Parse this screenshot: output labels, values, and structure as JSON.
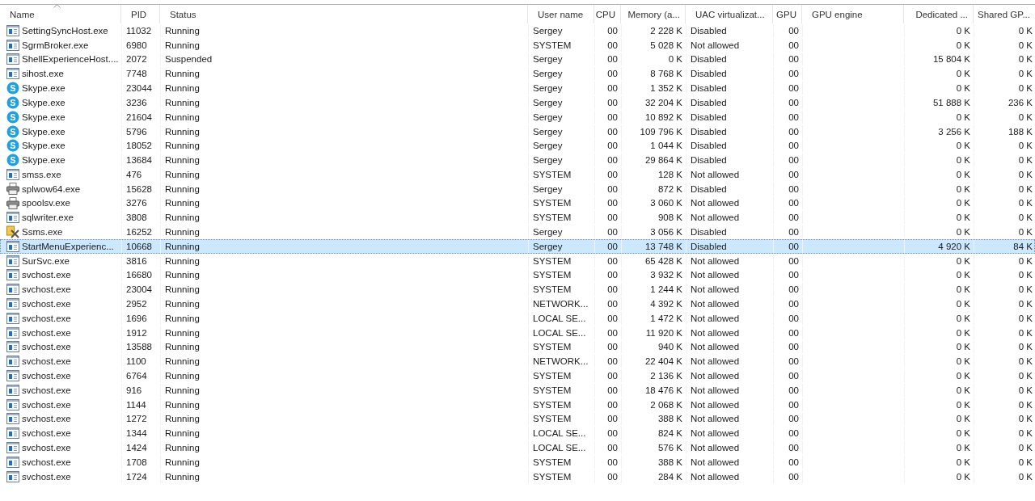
{
  "table": {
    "columns": [
      {
        "label": "Name",
        "sorted": true
      },
      {
        "label": "PID",
        "sorted": false
      },
      {
        "label": "Status",
        "sorted": false
      },
      {
        "label": "User name",
        "sorted": false
      },
      {
        "label": "CPU",
        "sorted": false
      },
      {
        "label": "Memory (a...",
        "sorted": false
      },
      {
        "label": "UAC virtualizat...",
        "sorted": false
      },
      {
        "label": "GPU",
        "sorted": false
      },
      {
        "label": "GPU engine",
        "sorted": false
      },
      {
        "label": "Dedicated ...",
        "sorted": false
      },
      {
        "label": "Shared GP...",
        "sorted": false
      }
    ],
    "rows": [
      {
        "kind": "app",
        "selected": false,
        "cells": [
          "SettingSyncHost.exe",
          "11032",
          "Running",
          "Sergey",
          "00",
          "2 228 K",
          "Disabled",
          "00",
          "",
          "0 K",
          "0 K"
        ]
      },
      {
        "kind": "app",
        "selected": false,
        "cells": [
          "SgrmBroker.exe",
          "6980",
          "Running",
          "SYSTEM",
          "00",
          "5 028 K",
          "Not allowed",
          "00",
          "",
          "0 K",
          "0 K"
        ]
      },
      {
        "kind": "app",
        "selected": false,
        "cells": [
          "ShellExperienceHost....",
          "2072",
          "Suspended",
          "Sergey",
          "00",
          "0 K",
          "Disabled",
          "00",
          "",
          "15 804 K",
          "0 K"
        ]
      },
      {
        "kind": "app",
        "selected": false,
        "cells": [
          "sihost.exe",
          "7748",
          "Running",
          "Sergey",
          "00",
          "8 768 K",
          "Disabled",
          "00",
          "",
          "0 K",
          "0 K"
        ]
      },
      {
        "kind": "skype",
        "icon_text": "S",
        "selected": false,
        "cells": [
          "Skype.exe",
          "23044",
          "Running",
          "Sergey",
          "00",
          "1 352 K",
          "Disabled",
          "00",
          "",
          "0 K",
          "0 K"
        ]
      },
      {
        "kind": "skype",
        "icon_text": "S",
        "selected": false,
        "cells": [
          "Skype.exe",
          "3236",
          "Running",
          "Sergey",
          "00",
          "32 204 K",
          "Disabled",
          "00",
          "",
          "51 888 K",
          "236 K"
        ]
      },
      {
        "kind": "skype",
        "icon_text": "S",
        "selected": false,
        "cells": [
          "Skype.exe",
          "21604",
          "Running",
          "Sergey",
          "00",
          "10 892 K",
          "Disabled",
          "00",
          "",
          "0 K",
          "0 K"
        ]
      },
      {
        "kind": "skype",
        "icon_text": "S",
        "selected": false,
        "cells": [
          "Skype.exe",
          "5796",
          "Running",
          "Sergey",
          "00",
          "109 796 K",
          "Disabled",
          "00",
          "",
          "3 256 K",
          "188 K"
        ]
      },
      {
        "kind": "skype",
        "icon_text": "S",
        "selected": false,
        "cells": [
          "Skype.exe",
          "18052",
          "Running",
          "Sergey",
          "00",
          "1 044 K",
          "Disabled",
          "00",
          "",
          "0 K",
          "0 K"
        ]
      },
      {
        "kind": "skype",
        "icon_text": "S",
        "selected": false,
        "cells": [
          "Skype.exe",
          "13684",
          "Running",
          "Sergey",
          "00",
          "29 864 K",
          "Disabled",
          "00",
          "",
          "0 K",
          "0 K"
        ]
      },
      {
        "kind": "app",
        "selected": false,
        "cells": [
          "smss.exe",
          "476",
          "Running",
          "SYSTEM",
          "00",
          "128 K",
          "Not allowed",
          "00",
          "",
          "0 K",
          "0 K"
        ]
      },
      {
        "kind": "printer",
        "selected": false,
        "cells": [
          "splwow64.exe",
          "15628",
          "Running",
          "Sergey",
          "00",
          "872 K",
          "Disabled",
          "00",
          "",
          "0 K",
          "0 K"
        ]
      },
      {
        "kind": "printer",
        "selected": false,
        "cells": [
          "spoolsv.exe",
          "3276",
          "Running",
          "SYSTEM",
          "00",
          "3 060 K",
          "Not allowed",
          "00",
          "",
          "0 K",
          "0 K"
        ]
      },
      {
        "kind": "app",
        "selected": false,
        "cells": [
          "sqlwriter.exe",
          "3808",
          "Running",
          "SYSTEM",
          "00",
          "908 K",
          "Not allowed",
          "00",
          "",
          "0 K",
          "0 K"
        ]
      },
      {
        "kind": "tools",
        "selected": false,
        "cells": [
          "Ssms.exe",
          "16252",
          "Running",
          "Sergey",
          "00",
          "3 056 K",
          "Disabled",
          "00",
          "",
          "0 K",
          "0 K"
        ]
      },
      {
        "kind": "app",
        "selected": true,
        "cells": [
          "StartMenuExperienc...",
          "10668",
          "Running",
          "Sergey",
          "00",
          "13 748 K",
          "Disabled",
          "00",
          "",
          "4 920 K",
          "84 K"
        ]
      },
      {
        "kind": "app",
        "selected": false,
        "cells": [
          "SurSvc.exe",
          "3816",
          "Running",
          "SYSTEM",
          "00",
          "65 428 K",
          "Not allowed",
          "00",
          "",
          "0 K",
          "0 K"
        ]
      },
      {
        "kind": "app",
        "selected": false,
        "cells": [
          "svchost.exe",
          "16680",
          "Running",
          "SYSTEM",
          "00",
          "3 932 K",
          "Not allowed",
          "00",
          "",
          "0 K",
          "0 K"
        ]
      },
      {
        "kind": "app",
        "selected": false,
        "cells": [
          "svchost.exe",
          "23004",
          "Running",
          "SYSTEM",
          "00",
          "1 244 K",
          "Not allowed",
          "00",
          "",
          "0 K",
          "0 K"
        ]
      },
      {
        "kind": "app",
        "selected": false,
        "cells": [
          "svchost.exe",
          "2952",
          "Running",
          "NETWORK...",
          "00",
          "4 392 K",
          "Not allowed",
          "00",
          "",
          "0 K",
          "0 K"
        ]
      },
      {
        "kind": "app",
        "selected": false,
        "cells": [
          "svchost.exe",
          "1696",
          "Running",
          "LOCAL SE...",
          "00",
          "1 472 K",
          "Not allowed",
          "00",
          "",
          "0 K",
          "0 K"
        ]
      },
      {
        "kind": "app",
        "selected": false,
        "cells": [
          "svchost.exe",
          "1912",
          "Running",
          "LOCAL SE...",
          "00",
          "11 920 K",
          "Not allowed",
          "00",
          "",
          "0 K",
          "0 K"
        ]
      },
      {
        "kind": "app",
        "selected": false,
        "cells": [
          "svchost.exe",
          "13588",
          "Running",
          "SYSTEM",
          "00",
          "940 K",
          "Not allowed",
          "00",
          "",
          "0 K",
          "0 K"
        ]
      },
      {
        "kind": "app",
        "selected": false,
        "cells": [
          "svchost.exe",
          "1100",
          "Running",
          "NETWORK...",
          "00",
          "22 404 K",
          "Not allowed",
          "00",
          "",
          "0 K",
          "0 K"
        ]
      },
      {
        "kind": "app",
        "selected": false,
        "cells": [
          "svchost.exe",
          "6764",
          "Running",
          "SYSTEM",
          "00",
          "2 136 K",
          "Not allowed",
          "00",
          "",
          "0 K",
          "0 K"
        ]
      },
      {
        "kind": "app",
        "selected": false,
        "cells": [
          "svchost.exe",
          "916",
          "Running",
          "SYSTEM",
          "00",
          "18 476 K",
          "Not allowed",
          "00",
          "",
          "0 K",
          "0 K"
        ]
      },
      {
        "kind": "app",
        "selected": false,
        "cells": [
          "svchost.exe",
          "1144",
          "Running",
          "SYSTEM",
          "00",
          "2 068 K",
          "Not allowed",
          "00",
          "",
          "0 K",
          "0 K"
        ]
      },
      {
        "kind": "app",
        "selected": false,
        "cells": [
          "svchost.exe",
          "1272",
          "Running",
          "SYSTEM",
          "00",
          "388 K",
          "Not allowed",
          "00",
          "",
          "0 K",
          "0 K"
        ]
      },
      {
        "kind": "app",
        "selected": false,
        "cells": [
          "svchost.exe",
          "1344",
          "Running",
          "LOCAL SE...",
          "00",
          "824 K",
          "Not allowed",
          "00",
          "",
          "0 K",
          "0 K"
        ]
      },
      {
        "kind": "app",
        "selected": false,
        "cells": [
          "svchost.exe",
          "1424",
          "Running",
          "LOCAL SE...",
          "00",
          "576 K",
          "Not allowed",
          "00",
          "",
          "0 K",
          "0 K"
        ]
      },
      {
        "kind": "app",
        "selected": false,
        "cells": [
          "svchost.exe",
          "1708",
          "Running",
          "SYSTEM",
          "00",
          "388 K",
          "Not allowed",
          "00",
          "",
          "0 K",
          "0 K"
        ]
      },
      {
        "kind": "app",
        "selected": false,
        "cells": [
          "svchost.exe",
          "1724",
          "Running",
          "SYSTEM",
          "00",
          "284 K",
          "Not allowed",
          "00",
          "",
          "0 K",
          "0 K"
        ]
      }
    ]
  }
}
